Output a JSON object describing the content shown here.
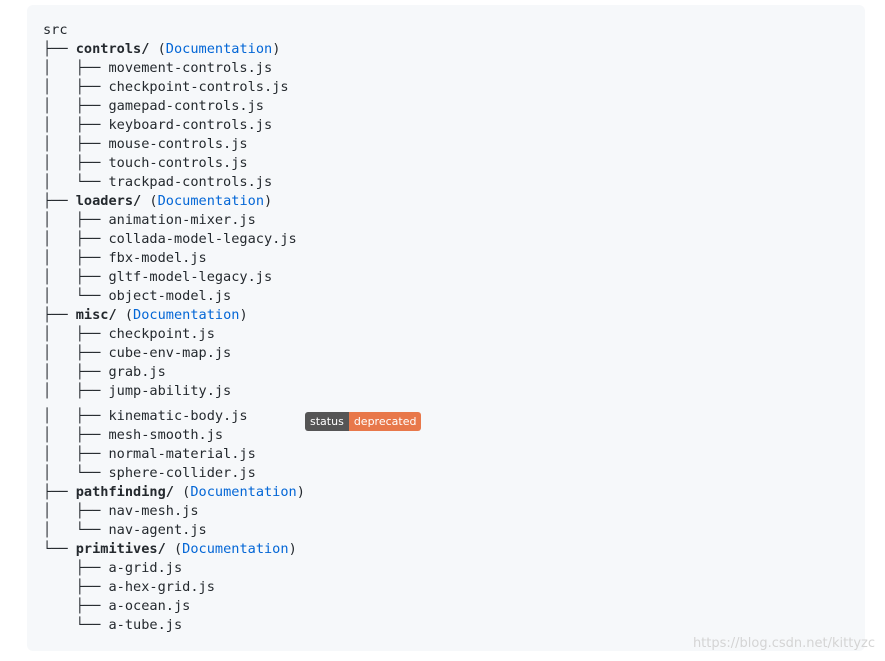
{
  "root": "src",
  "doc_link_text": "Documentation",
  "groups": [
    {
      "prefix": "├── ",
      "dir": "controls/",
      "files": [
        [
          "│   ├── ",
          "movement-controls.js"
        ],
        [
          "│   ├── ",
          "checkpoint-controls.js"
        ],
        [
          "│   ├── ",
          "gamepad-controls.js"
        ],
        [
          "│   ├── ",
          "keyboard-controls.js"
        ],
        [
          "│   ├── ",
          "mouse-controls.js"
        ],
        [
          "│   ├── ",
          "touch-controls.js"
        ],
        [
          "│   └── ",
          "trackpad-controls.js"
        ]
      ]
    },
    {
      "prefix": "├── ",
      "dir": "loaders/",
      "files": [
        [
          "│   ├── ",
          "animation-mixer.js"
        ],
        [
          "│   ├── ",
          "collada-model-legacy.js"
        ],
        [
          "│   ├── ",
          "fbx-model.js"
        ],
        [
          "│   ├── ",
          "gltf-model-legacy.js"
        ],
        [
          "│   └── ",
          "object-model.js"
        ]
      ]
    },
    {
      "prefix": "├── ",
      "dir": "misc/",
      "files": [
        [
          "│   ├── ",
          "checkpoint.js"
        ],
        [
          "│   ├── ",
          "cube-env-map.js"
        ],
        [
          "│   ├── ",
          "grab.js"
        ],
        [
          "│   ├── ",
          "jump-ability.js"
        ],
        [
          "│   ├── ",
          "kinematic-body.js"
        ],
        [
          "│   ├── ",
          "mesh-smooth.js"
        ],
        [
          "│   ├── ",
          "normal-material.js"
        ],
        [
          "│   └── ",
          "sphere-collider.js"
        ]
      ]
    },
    {
      "prefix": "├── ",
      "dir": "pathfinding/",
      "files": [
        [
          "│   ├── ",
          "nav-mesh.js"
        ],
        [
          "│   └── ",
          "nav-agent.js"
        ]
      ]
    },
    {
      "prefix": "└── ",
      "dir": "primitives/",
      "files": [
        [
          "    ├── ",
          "a-grid.js"
        ],
        [
          "    ├── ",
          "a-hex-grid.js"
        ],
        [
          "    ├── ",
          "a-ocean.js"
        ],
        [
          "    └── ",
          "a-tube.js"
        ]
      ]
    }
  ],
  "badge": {
    "file": "kinematic-body.js",
    "label": "status",
    "value": "deprecated",
    "label_color": "#555555",
    "value_color": "#e8784a"
  },
  "watermark": "https://blog.csdn.net/kittyzc",
  "colors": {
    "link": "#0366d6",
    "panel": "#f6f8fa",
    "text": "#24292e"
  }
}
